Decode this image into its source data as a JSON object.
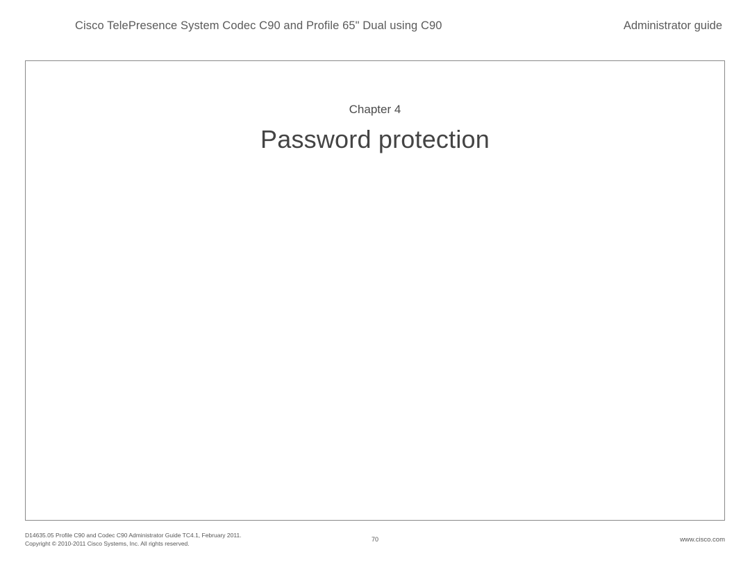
{
  "header": {
    "product_title": "Cisco TelePresence System Codec C90 and Profile 65\" Dual using C90",
    "doc_type": "Administrator guide"
  },
  "content": {
    "chapter_label": "Chapter 4",
    "chapter_title": "Password protection"
  },
  "footer": {
    "doc_id": "D14635.05 Profile C90 and Codec C90 Administrator Guide TC4.1, February 2011.",
    "copyright": "Copyright © 2010-2011 Cisco Systems, Inc. All rights reserved.",
    "page_number": "70",
    "url": "www.cisco.com"
  }
}
